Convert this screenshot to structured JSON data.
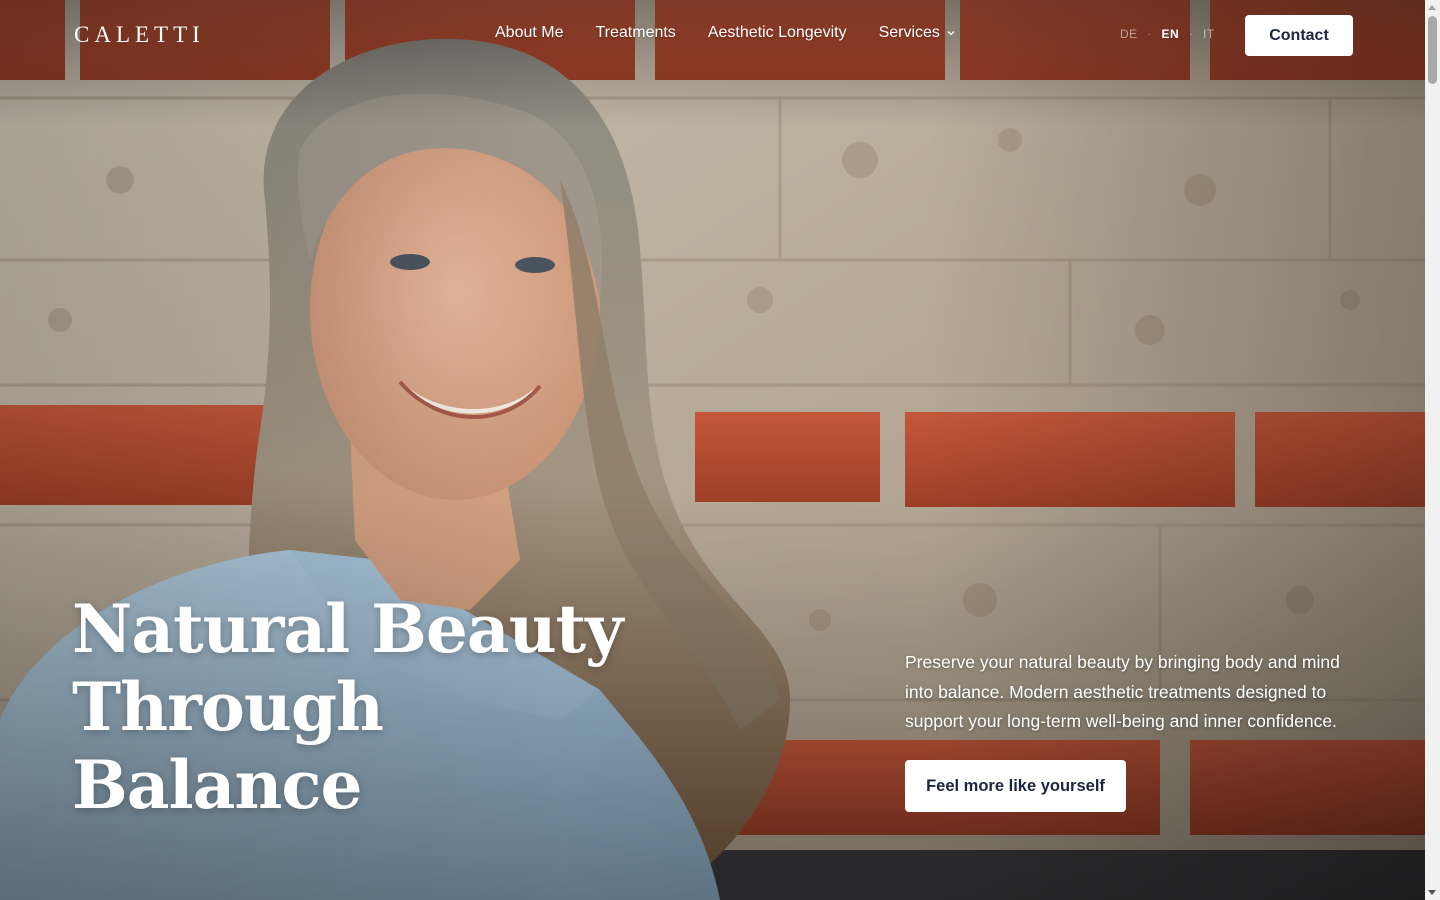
{
  "header": {
    "logo": "CALETTI",
    "nav": [
      {
        "label": "About Me"
      },
      {
        "label": "Treatments"
      },
      {
        "label": "Aesthetic Longevity"
      },
      {
        "label": "Services",
        "has_dropdown": true
      }
    ],
    "languages": [
      {
        "code": "DE",
        "active": false
      },
      {
        "code": "EN",
        "active": true
      },
      {
        "code": "IT",
        "active": false
      }
    ],
    "contact_label": "Contact"
  },
  "hero": {
    "headline": [
      "Natural Beauty",
      "Through",
      "Balance"
    ],
    "intro": "Preserve your natural beauty by bringing body and mind into balance. Modern aesthetic treatments designed to support your long-term well-being and inner confidence.",
    "cta_label": "Feel more like yourself",
    "image_description_icon": "hero-portrait-image"
  },
  "colors": {
    "button_text": "#1c2541",
    "brick": "#b24a2f",
    "mortar": "#bdb1a2"
  }
}
